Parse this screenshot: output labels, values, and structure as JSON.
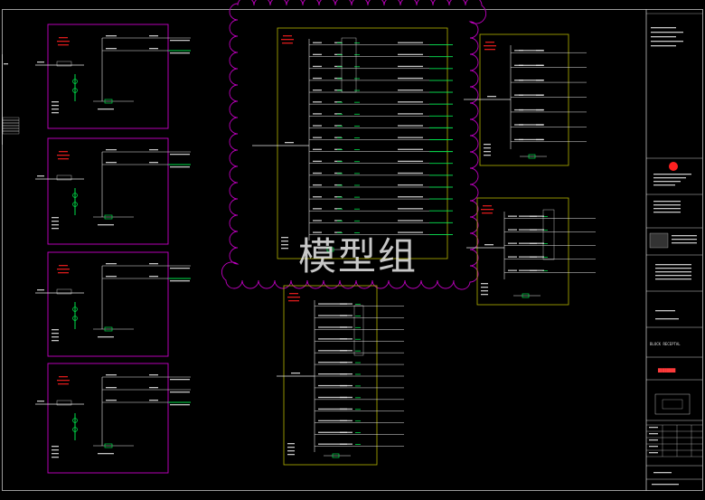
{
  "watermark": "模型组",
  "title_block": {
    "drawing_label": "BLOCK  RECEPTAL",
    "red_label": "████████",
    "logo_label": "logo"
  },
  "colors": {
    "background": "#000000",
    "frame_magenta": "#c800c8",
    "frame_olive": "#b4b400",
    "wire_white": "#e6e6e6",
    "wire_green": "#00e04a",
    "text_red": "#ff2020",
    "cloud": "#c000c0",
    "border": "#ffffff"
  },
  "panels": [
    {
      "id": "p1",
      "frame": "magenta",
      "feeders": 2
    },
    {
      "id": "p2",
      "frame": "magenta",
      "feeders": 2
    },
    {
      "id": "p3",
      "frame": "magenta",
      "feeders": 2
    },
    {
      "id": "p4",
      "frame": "magenta",
      "feeders": 3
    },
    {
      "id": "p5",
      "frame": "olive",
      "feeders": 17
    },
    {
      "id": "p6",
      "frame": "olive",
      "feeders": 7
    },
    {
      "id": "p7",
      "frame": "olive",
      "feeders": 5
    },
    {
      "id": "p8",
      "frame": "olive",
      "feeders": 13
    }
  ]
}
